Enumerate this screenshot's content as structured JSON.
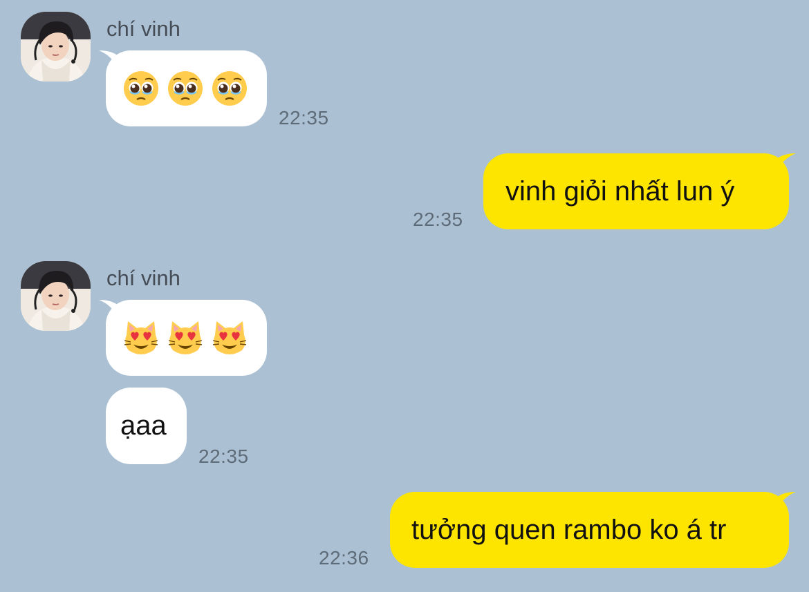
{
  "chat": {
    "messages": [
      {
        "id": "m1",
        "direction": "incoming",
        "sender": "chí vinh",
        "content_type": "emoji",
        "emoji": [
          "pleading-face",
          "pleading-face",
          "pleading-face"
        ],
        "time": "22:35"
      },
      {
        "id": "m2",
        "direction": "outgoing",
        "content_type": "text",
        "text": "vinh giỏi nhất lun ý",
        "time": "22:35"
      },
      {
        "id": "m3",
        "direction": "incoming",
        "sender": "chí vinh",
        "content_type": "emoji",
        "emoji": [
          "heart-eyes-cat",
          "heart-eyes-cat",
          "heart-eyes-cat"
        ]
      },
      {
        "id": "m4",
        "direction": "incoming",
        "content_type": "text",
        "text": "ạaa",
        "time": "22:35"
      },
      {
        "id": "m5",
        "direction": "outgoing",
        "content_type": "text",
        "text": "tưởng quen rambo ko á tr",
        "time": "22:36"
      }
    ]
  },
  "colors": {
    "background": "#abc1d3",
    "incoming_bubble": "#ffffff",
    "outgoing_bubble": "#fee500",
    "timestamp": "#5e6b78",
    "sender_name": "#454c55"
  }
}
